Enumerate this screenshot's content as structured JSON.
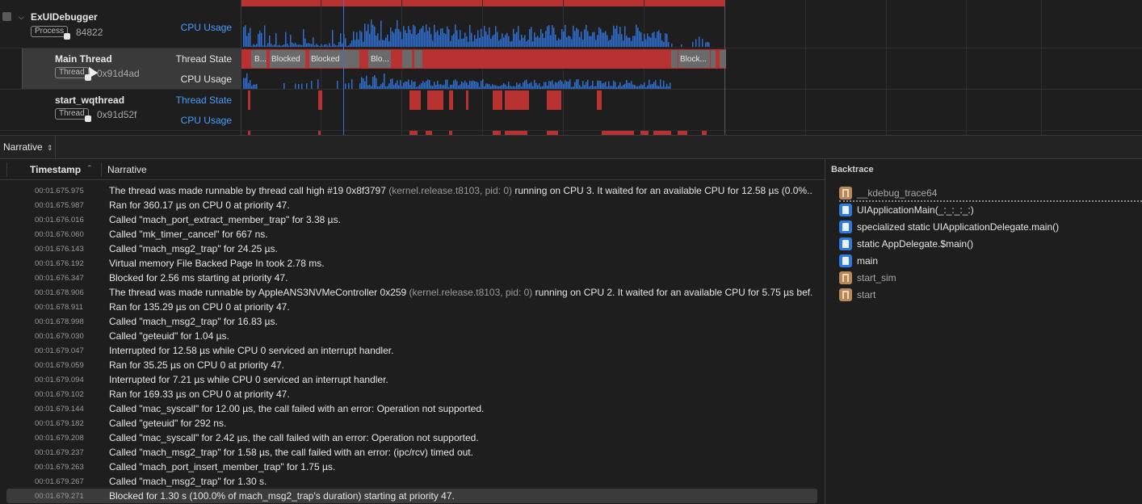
{
  "process": {
    "name": "ExUIDebugger",
    "tag": "Process",
    "pid": "84822",
    "lane": "CPU Usage"
  },
  "threads": [
    {
      "name": "Main Thread",
      "tag": "Thread",
      "id": "0x91d4ad",
      "lane1": "Thread State",
      "lane2": "CPU Usage"
    },
    {
      "name": "start_wqthread",
      "tag": "Thread",
      "id": "0x91d52f",
      "lane1": "Thread State",
      "lane2": "CPU Usage"
    }
  ],
  "state_labels": [
    "B...",
    "Blocked",
    "Blocked",
    "Blo...",
    "Block..."
  ],
  "scope": {
    "label": "Narrative"
  },
  "table": {
    "col_timestamp": "Timestamp",
    "col_narrative": "Narrative",
    "rows": [
      {
        "ts": "00:01.675.975",
        "text": "The thread was made runnable by thread call high #19  0x8f3797 ",
        "dim": "(kernel.release.t8103, pid: 0)",
        "tail": " running on CPU 3. It waited for an available CPU for 12.58 µs (0.0%..."
      },
      {
        "ts": "00:01.675.987",
        "text": "Ran for 360.17 µs on CPU 0 at priority 47."
      },
      {
        "ts": "00:01.676.016",
        "text": "Called \"mach_port_extract_member_trap\" for 3.38 µs."
      },
      {
        "ts": "00:01.676.060",
        "text": "Called \"mk_timer_cancel\" for 667 ns."
      },
      {
        "ts": "00:01.676.143",
        "text": "Called \"mach_msg2_trap\" for 24.25 µs."
      },
      {
        "ts": "00:01.676.192",
        "text": "Virtual memory File Backed Page In took 2.78 ms."
      },
      {
        "ts": "00:01.676.347",
        "text": "Blocked for 2.56 ms starting at priority 47."
      },
      {
        "ts": "00:01.678.906",
        "text": "The thread was made runnable by AppleANS3NVMeController  0x259 ",
        "dim": "(kernel.release.t8103, pid: 0)",
        "tail": " running on CPU 2. It waited for an available CPU for 5.75 µs bef..."
      },
      {
        "ts": "00:01.678.911",
        "text": "Ran for 135.29 µs on CPU 0 at priority 47."
      },
      {
        "ts": "00:01.678.998",
        "text": "Called \"mach_msg2_trap\" for 16.83 µs."
      },
      {
        "ts": "00:01.679.030",
        "text": "Called \"geteuid\" for 1.04 µs."
      },
      {
        "ts": "00:01.679.047",
        "text": "Interrupted for 12.58 µs while CPU 0 serviced an interrupt handler."
      },
      {
        "ts": "00:01.679.059",
        "text": "Ran for 35.25 µs on CPU 0 at priority 47."
      },
      {
        "ts": "00:01.679.094",
        "text": "Interrupted for 7.21 µs while CPU 0 serviced an interrupt handler."
      },
      {
        "ts": "00:01.679.102",
        "text": "Ran for 169.33 µs on CPU 0 at priority 47."
      },
      {
        "ts": "00:01.679.144",
        "text": "Called \"mac_syscall\" for 12.00 µs, the call failed with an error: Operation not supported."
      },
      {
        "ts": "00:01.679.182",
        "text": "Called \"geteuid\" for 292 ns."
      },
      {
        "ts": "00:01.679.208",
        "text": "Called \"mac_syscall\" for 2.42 µs, the call failed with an error: Operation not supported."
      },
      {
        "ts": "00:01.679.237",
        "text": "Called \"mach_msg2_trap\" for 1.58 µs, the call failed with an error: (ipc/rcv) timed out."
      },
      {
        "ts": "00:01.679.263",
        "text": "Called \"mach_port_insert_member_trap\" for 1.75 µs."
      },
      {
        "ts": "00:01.679.267",
        "text": "Called \"mach_msg2_trap\" for 1.30 s."
      },
      {
        "ts": "00:01.679.271",
        "text": "Blocked for 1.30 s (100.0% of mach_msg2_trap's duration) starting at priority 47.",
        "selected": true
      }
    ]
  },
  "backtrace": {
    "title": "Backtrace",
    "frames": [
      {
        "name": "__kdebug_trace64",
        "kind": "sys"
      },
      {
        "name": "UIApplicationMain(_:_:_:_:)",
        "kind": "user"
      },
      {
        "name": "specialized static UIApplicationDelegate.main()",
        "kind": "user"
      },
      {
        "name": "static AppDelegate.$main()",
        "kind": "user"
      },
      {
        "name": "main",
        "kind": "user"
      },
      {
        "name": "start_sim",
        "kind": "sys"
      },
      {
        "name": "start",
        "kind": "sys"
      }
    ]
  },
  "colors": {
    "accent": "#4a9dff",
    "cpu_bar": "#2f6fd0",
    "blocked": "#b83232",
    "state_gray": "#6a6a6a",
    "background": "#1e1e1e"
  }
}
